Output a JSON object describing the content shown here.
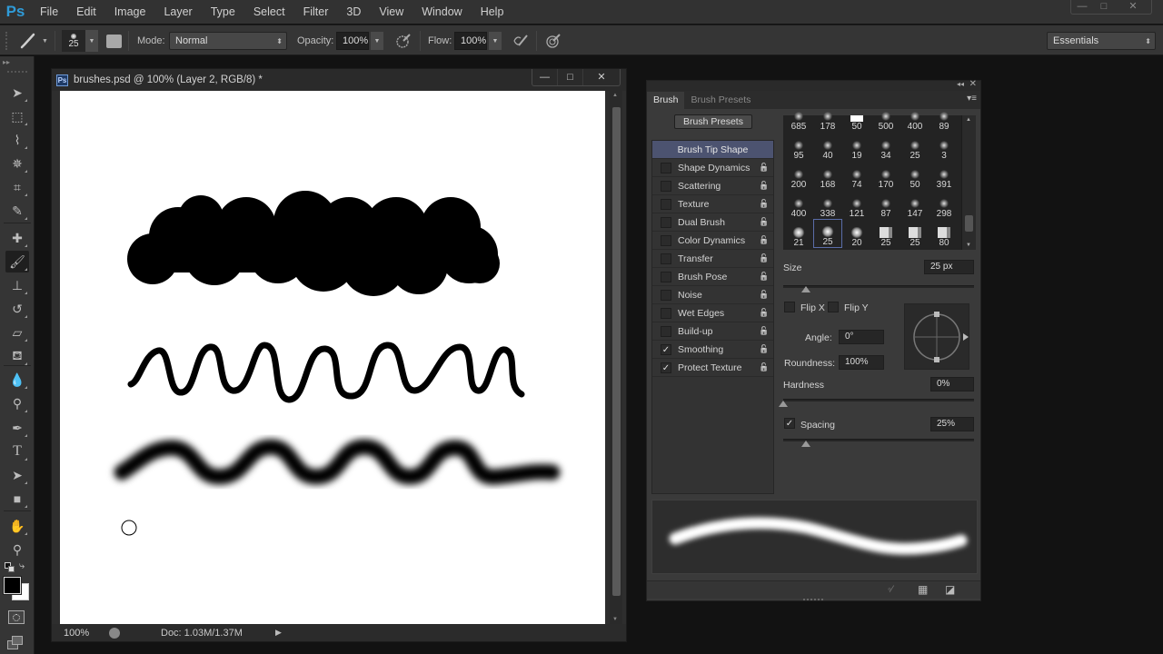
{
  "app": {
    "logo": "Ps",
    "menu": [
      "File",
      "Edit",
      "Image",
      "Layer",
      "Type",
      "Select",
      "Filter",
      "3D",
      "View",
      "Window",
      "Help"
    ],
    "window_controls": {
      "minimize": "—",
      "maximize": "□",
      "close": "✕"
    }
  },
  "options_bar": {
    "brush_size": "25",
    "mode_label": "Mode:",
    "mode_value": "Normal",
    "opacity_label": "Opacity:",
    "opacity_value": "100%",
    "flow_label": "Flow:",
    "flow_value": "100%",
    "workspace": "Essentials"
  },
  "toolbox": {
    "tools": [
      {
        "name": "move-tool",
        "glyph": "➤"
      },
      {
        "name": "marquee-tool",
        "glyph": "⬚"
      },
      {
        "name": "lasso-tool",
        "glyph": "⌇"
      },
      {
        "name": "magic-wand-tool",
        "glyph": "✵"
      },
      {
        "name": "crop-tool",
        "glyph": "⌗"
      },
      {
        "name": "eyedropper-tool",
        "glyph": "✎"
      },
      {
        "name": "healing-brush-tool",
        "glyph": "✚"
      },
      {
        "name": "brush-tool",
        "glyph": "🖌"
      },
      {
        "name": "clone-stamp-tool",
        "glyph": "⊥"
      },
      {
        "name": "history-brush-tool",
        "glyph": "↺"
      },
      {
        "name": "eraser-tool",
        "glyph": "▱"
      },
      {
        "name": "paint-bucket-tool",
        "glyph": "⛾"
      },
      {
        "name": "blur-tool",
        "glyph": "💧"
      },
      {
        "name": "dodge-tool",
        "glyph": "⚲"
      },
      {
        "name": "pen-tool",
        "glyph": "✒"
      },
      {
        "name": "type-tool",
        "glyph": "T"
      },
      {
        "name": "path-selection-tool",
        "glyph": "➤"
      },
      {
        "name": "rectangle-tool",
        "glyph": "■"
      },
      {
        "name": "hand-tool",
        "glyph": "✋"
      },
      {
        "name": "zoom-tool",
        "glyph": "⚲"
      }
    ],
    "foreground_color": "#000000",
    "background_color": "#ffffff"
  },
  "document": {
    "title": "brushes.psd @ 100% (Layer 2, RGB/8) *",
    "zoom": "100%",
    "doc_info": "Doc: 1.03M/1.37M"
  },
  "brush_panel": {
    "tabs": [
      "Brush",
      "Brush Presets"
    ],
    "active_tab": "Brush",
    "presets_button": "Brush Presets",
    "sections": [
      {
        "label": "Brush Tip Shape",
        "header": true
      },
      {
        "label": "Shape Dynamics",
        "checked": false
      },
      {
        "label": "Scattering",
        "checked": false
      },
      {
        "label": "Texture",
        "checked": false
      },
      {
        "label": "Dual Brush",
        "checked": false
      },
      {
        "label": "Color Dynamics",
        "checked": false
      },
      {
        "label": "Transfer",
        "checked": false
      },
      {
        "label": "Brush Pose",
        "checked": false
      },
      {
        "label": "Noise",
        "checked": false
      },
      {
        "label": "Wet Edges",
        "checked": false
      },
      {
        "label": "Build-up",
        "checked": false
      },
      {
        "label": "Smoothing",
        "checked": true
      },
      {
        "label": "Protect Texture",
        "checked": true
      }
    ],
    "tips": [
      [
        "685",
        "178",
        "50",
        "500",
        "400",
        "89"
      ],
      [
        "95",
        "40",
        "19",
        "34",
        "25",
        "3"
      ],
      [
        "200",
        "168",
        "74",
        "170",
        "50",
        "391"
      ],
      [
        "400",
        "338",
        "121",
        "87",
        "147",
        "298"
      ],
      [
        "21",
        "25",
        "20",
        "25",
        "25",
        "80"
      ]
    ],
    "selected_tip": {
      "row": 4,
      "col": 1
    },
    "size_label": "Size",
    "size_value": "25 px",
    "size_slider_fraction": 0.12,
    "flip_x_label": "Flip X",
    "flip_y_label": "Flip Y",
    "flip_x": false,
    "flip_y": false,
    "angle_label": "Angle:",
    "angle_value": "0°",
    "roundness_label": "Roundness:",
    "roundness_value": "100%",
    "hardness_label": "Hardness",
    "hardness_value": "0%",
    "hardness_slider_fraction": 0.0,
    "spacing_label": "Spacing",
    "spacing_checked": true,
    "spacing_value": "25%",
    "spacing_slider_fraction": 0.12
  }
}
